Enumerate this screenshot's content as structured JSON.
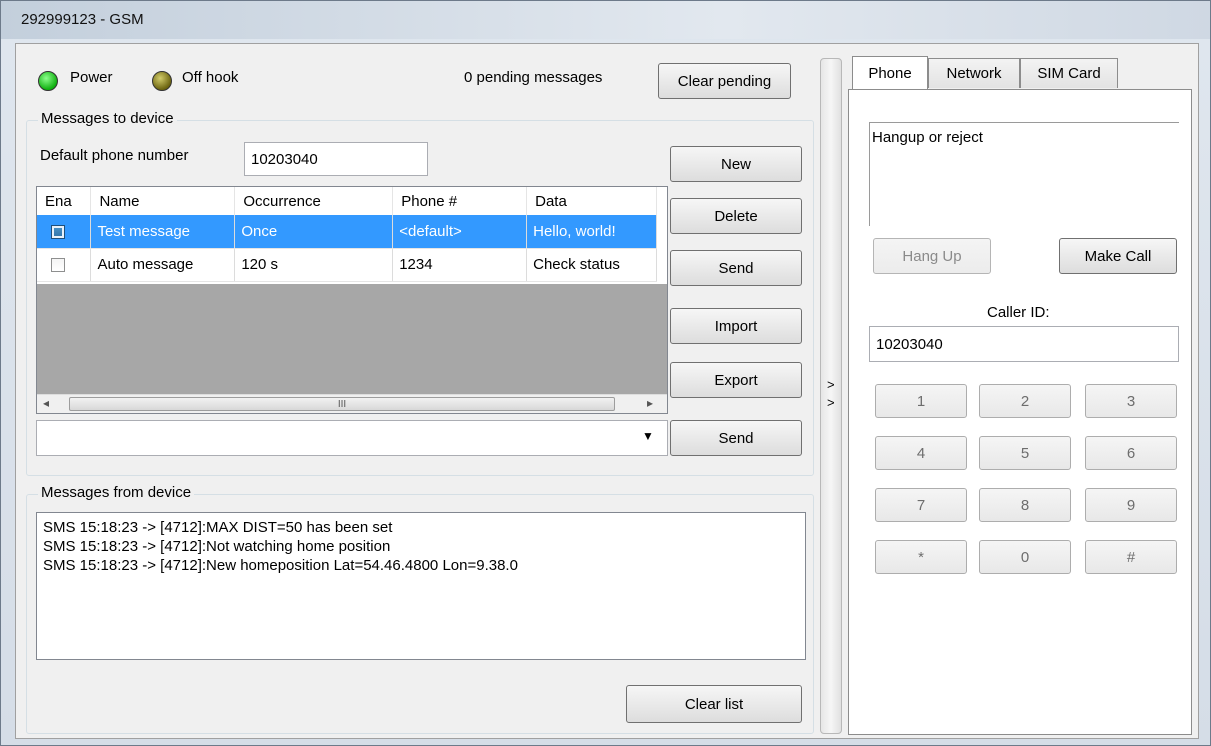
{
  "window": {
    "title": "292999123 - GSM"
  },
  "status": {
    "power_label": "Power",
    "offhook_label": "Off hook",
    "pending_text": "0 pending messages",
    "clear_pending_label": "Clear pending"
  },
  "to_device": {
    "group_label": "Messages to device",
    "default_phone_label": "Default phone number",
    "default_phone_value": "10203040",
    "columns": [
      "Ena",
      "Name",
      "Occurrence",
      "Phone #",
      "Data"
    ],
    "rows": [
      {
        "enabled": true,
        "name": "Test message",
        "occurrence": "Once",
        "phone": "<default>",
        "data": "Hello, world!"
      },
      {
        "enabled": false,
        "name": "Auto message",
        "occurrence": "120 s",
        "phone": "1234",
        "data": "Check status"
      }
    ],
    "buttons": {
      "new": "New",
      "delete": "Delete",
      "send": "Send",
      "import": "Import",
      "export": "Export",
      "send2": "Send"
    },
    "scroll_thumb_glyph": "III",
    "combo_value": ""
  },
  "from_device": {
    "group_label": "Messages from device",
    "lines": [
      "SMS 15:18:23 -> [4712]:MAX DIST=50 has been set",
      "SMS 15:18:23 -> [4712]:Not watching home position",
      "SMS 15:18:23 -> [4712]:New homeposition Lat=54.46.4800 Lon=9.38.0"
    ],
    "clear_label": "Clear list"
  },
  "splitter": {
    "glyph1": ">",
    "glyph2": ">"
  },
  "phone": {
    "tabs": [
      "Phone",
      "Network",
      "SIM Card"
    ],
    "status_text": "Hangup or reject",
    "hangup_label": "Hang Up",
    "makecall_label": "Make Call",
    "caller_id_label": "Caller ID:",
    "caller_id_value": "10203040",
    "keys": [
      "1",
      "2",
      "3",
      "4",
      "5",
      "6",
      "7",
      "8",
      "9",
      "*",
      "0",
      "#"
    ]
  }
}
